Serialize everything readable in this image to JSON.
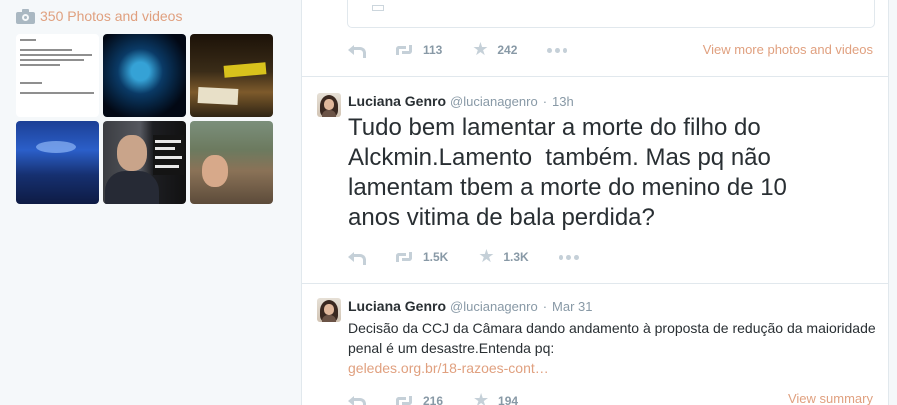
{
  "sidebar": {
    "photos_label": "350 Photos and videos",
    "thumbnails": [
      {
        "icon": "document-screenshot"
      },
      {
        "icon": "blue-stage-photo"
      },
      {
        "icon": "protest-night-photo"
      },
      {
        "icon": "concert-crowd-photo"
      },
      {
        "icon": "politician-photo"
      },
      {
        "icon": "crowd-meeting-photo"
      }
    ]
  },
  "top_tweet": {
    "retweets": "113",
    "likes": "242",
    "view_more": "View more photos and videos"
  },
  "tweets": [
    {
      "name": "Luciana Genro",
      "handle": "@lucianagenro",
      "time": "13h",
      "text": "Tudo bem lamentar a morte do filho do\nAlckmin.Lamento  também. Mas pq não\nlamentam tbem a morte do menino de 10\nanos vitima de bala perdida?",
      "retweets": "1.5K",
      "likes": "1.3K"
    },
    {
      "name": "Luciana Genro",
      "handle": "@lucianagenro",
      "time": "Mar 31",
      "text": "Decisão da CCJ da Câmara dando andamento à proposta de redução da maioridade penal é um desastre.Entenda pq:",
      "link": "geledes.org.br/18-razoes-cont…",
      "retweets": "216",
      "likes": "194",
      "view_summary": "View summary"
    }
  ],
  "colors": {
    "link": "#e0a07f",
    "muted": "#8899a6",
    "icon": "#c5d0d8",
    "background": "#f5f8fa"
  }
}
